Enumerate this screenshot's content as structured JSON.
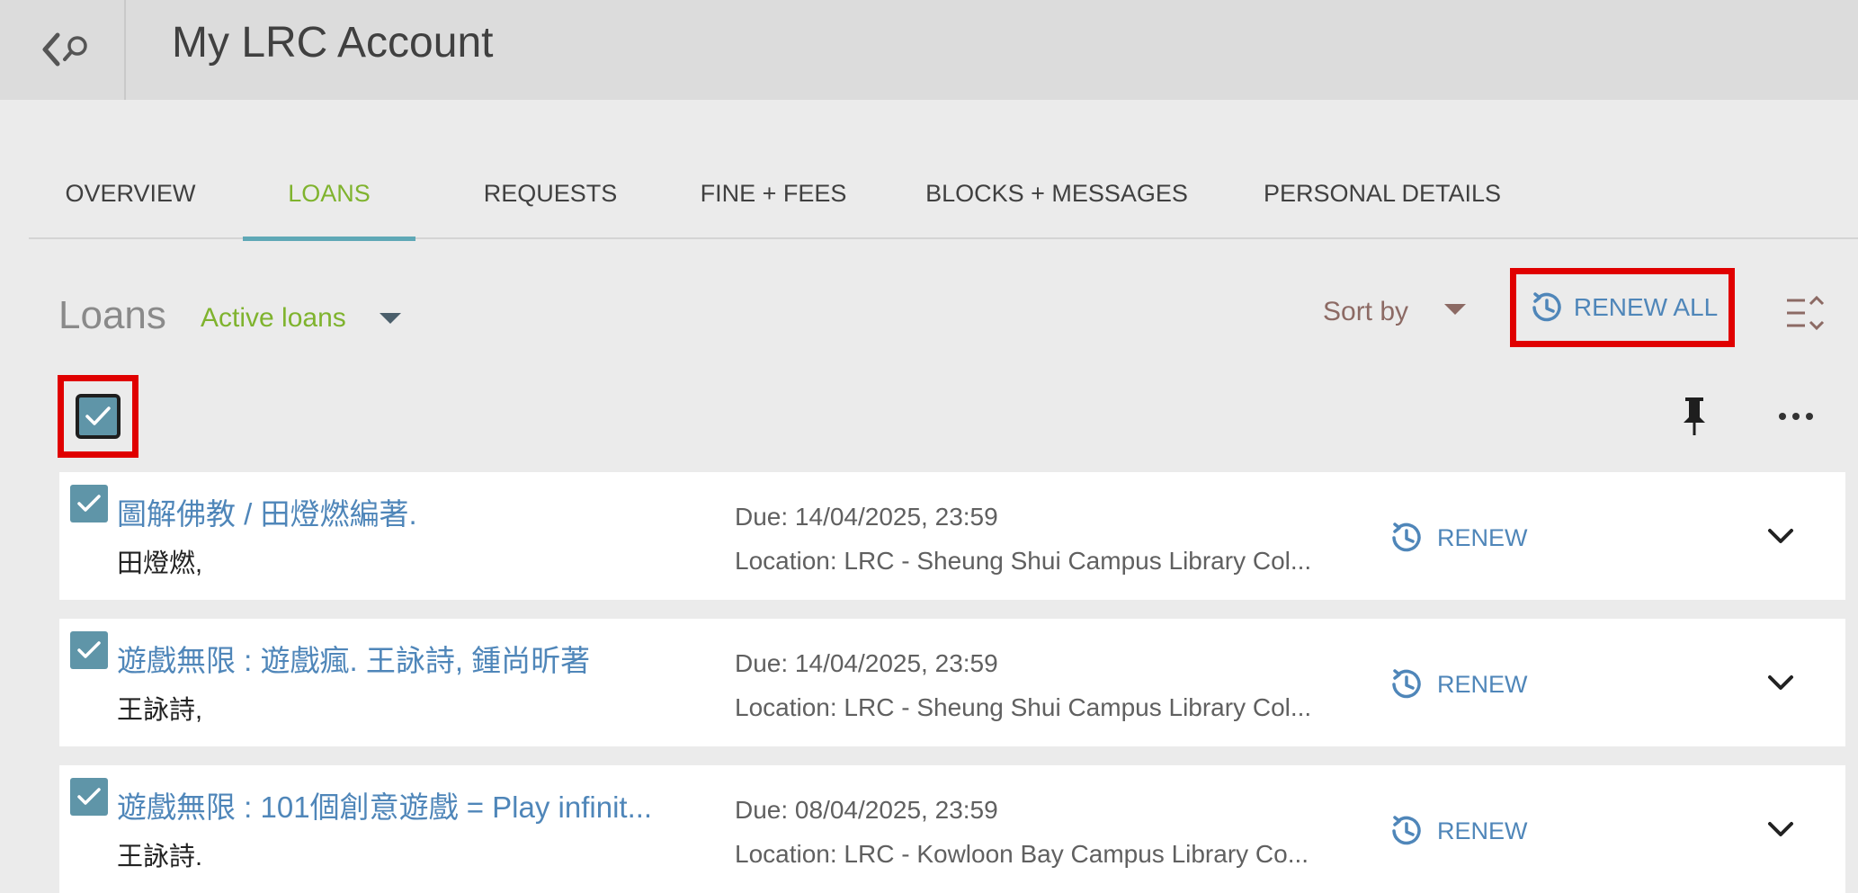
{
  "header": {
    "title": "My LRC Account",
    "back_search_icon": "back-search-icon"
  },
  "tabs": [
    {
      "label": "OVERVIEW",
      "active": false
    },
    {
      "label": "LOANS",
      "active": true
    },
    {
      "label": "REQUESTS",
      "active": false
    },
    {
      "label": "FINE + FEES",
      "active": false
    },
    {
      "label": "BLOCKS + MESSAGES",
      "active": false
    },
    {
      "label": "PERSONAL DETAILS",
      "active": false
    }
  ],
  "loans": {
    "title": "Loans",
    "filter": "Active loans",
    "sort_label": "Sort by",
    "renew_all_label": "RENEW ALL",
    "select_all_checked": true
  },
  "items": [
    {
      "title": "圖解佛教 / 田燈燃編著.",
      "author": "田燈燃,",
      "due": "Due: 14/04/2025, 23:59",
      "location": "Location: LRC - Sheung Shui Campus Library Col...",
      "renew_label": "RENEW",
      "checked": true
    },
    {
      "title": "遊戲無限 : 遊戲瘋. 王詠詩, 鍾尚昕著",
      "author": "王詠詩,",
      "due": "Due: 14/04/2025, 23:59",
      "location": "Location: LRC - Sheung Shui Campus Library Col...",
      "renew_label": "RENEW",
      "checked": true
    },
    {
      "title": "遊戲無限 : 101個創意遊戲 = Play infinit...",
      "author": "王詠詩.",
      "due": "Due: 08/04/2025, 23:59",
      "location": "Location: LRC - Kowloon Bay Campus Library Co...",
      "renew_label": "RENEW",
      "checked": true
    }
  ],
  "colors": {
    "accent_green": "#7fb32e",
    "link_blue": "#4f86b9",
    "checkbox": "#5f95a8",
    "highlight_red": "#e00000"
  }
}
